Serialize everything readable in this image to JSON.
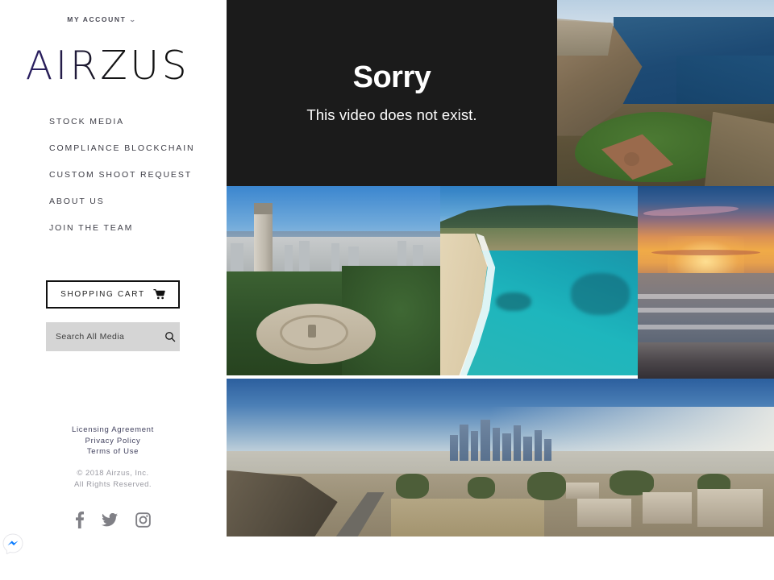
{
  "brand": {
    "logo_text": "AIRZUS",
    "logo_gradient_start": "#241a5e",
    "logo_gradient_end": "#0b0b0b"
  },
  "topbar": {
    "account_label": "MY ACCOUNT",
    "account_chevron": "chevron-down-icon"
  },
  "sidebar": {
    "nav_items": [
      {
        "label": "STOCK MEDIA"
      },
      {
        "label": "COMPLIANCE BLOCKCHAIN"
      },
      {
        "label": "CUSTOM SHOOT REQUEST"
      },
      {
        "label": "ABOUT US"
      },
      {
        "label": "JOIN THE TEAM"
      }
    ],
    "cart": {
      "label": "SHOPPING CART",
      "icon": "shopping-cart-icon"
    },
    "search": {
      "placeholder": "Search All Media",
      "value": "",
      "icon": "search-icon",
      "background": "#d5d5d5"
    },
    "footer_links": [
      {
        "label": "Licensing Agreement"
      },
      {
        "label": "Privacy Policy"
      },
      {
        "label": "Terms of Use"
      }
    ],
    "copyright": [
      "© 2018 Airzus, Inc.",
      "All Rights Reserved."
    ],
    "socials": [
      {
        "name": "facebook-icon",
        "glyph": "f"
      },
      {
        "name": "twitter-icon",
        "glyph": "twitter"
      },
      {
        "name": "instagram-icon",
        "glyph": "instagram"
      }
    ]
  },
  "main": {
    "video_error": {
      "title": "Sorry",
      "subtitle": "This video does not exist.",
      "background": "#1b1b1b",
      "text_color": "#ffffff"
    },
    "gallery": [
      {
        "name": "coastal-baseball-field",
        "alt": "Aerial view of a coastal bluff with a baseball field overlooking the ocean"
      },
      {
        "name": "san-francisco-coit-tower",
        "alt": "Aerial view of Coit Tower and the San Francisco skyline"
      },
      {
        "name": "turquoise-beach-cove",
        "alt": "Aerial view of a turquoise beach cove with sandy shoreline"
      },
      {
        "name": "ocean-sunset",
        "alt": "Sunset over the ocean with orange sky and breaking waves"
      },
      {
        "name": "los-angeles-skyline-panorama",
        "alt": "Panoramic aerial of downtown Los Angeles skyline from a hillside neighborhood"
      }
    ]
  },
  "widgets": {
    "messenger": {
      "name": "messenger-chat-icon",
      "color": "#0a7cff"
    }
  }
}
